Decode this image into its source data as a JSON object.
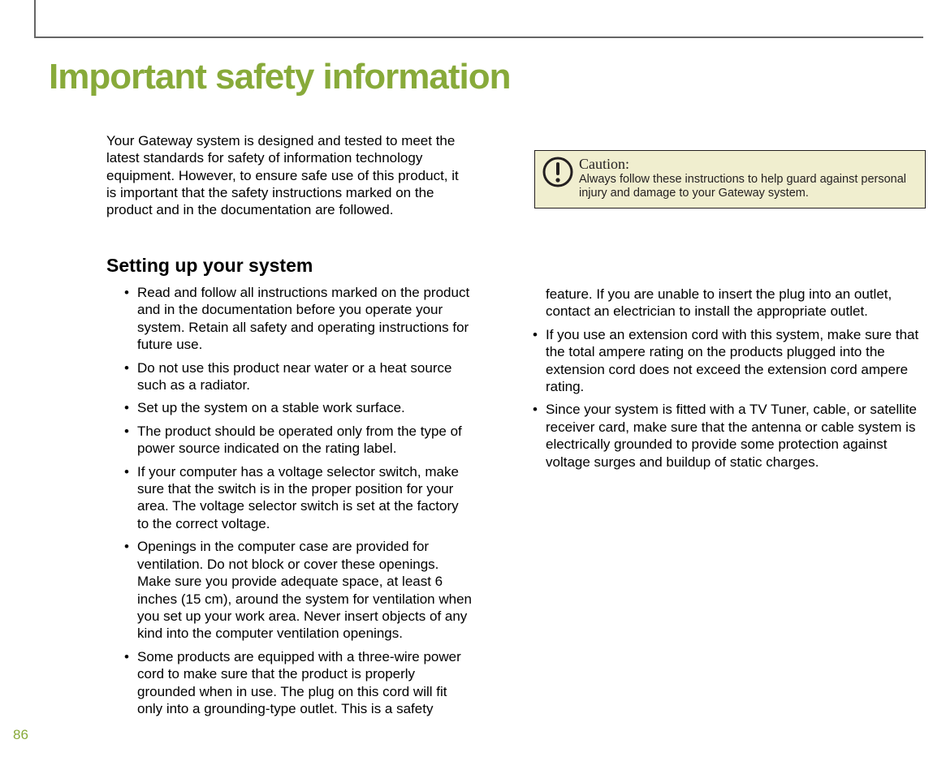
{
  "page_number": "86",
  "title": "Important safety information",
  "intro": "Your Gateway system is designed and tested to meet the latest standards for safety of information technology equipment. However, to ensure safe use of this product, it is important that the safety instructions marked on the product and in the documentation are followed.",
  "caution": {
    "label": "Caution:",
    "body": "Always follow these instructions to help guard against personal injury and damage to your Gateway system."
  },
  "section_heading": "Setting up your system",
  "left_bullets": [
    "Read and follow all instructions marked on the product and in the documentation before you operate your system. Retain all safety and operating instructions for future use.",
    "Do not use this product near water or a heat source such as a radiator.",
    "Set up the system on a stable work surface.",
    "The product should be operated only from the type of power source indicated on the rating label.",
    "If your computer has a voltage selector switch, make sure that the switch is in the proper position for your area. The voltage selector switch is set at the factory to the correct voltage.",
    "Openings in the computer case are provided for ventilation. Do not block or cover these openings. Make sure you provide adequate space, at least 6 inches (15 cm), around the system for ventilation when you set up your work area. Never insert objects of any kind into the computer ventilation openings.",
    "Some products are equipped with a three-wire power cord to make sure that the product is properly grounded when in use. The plug on this cord will fit only into a grounding-type outlet. This is a safety"
  ],
  "right_continuation": "feature. If you are unable to insert the plug into an outlet, contact an electrician to install the appropriate outlet.",
  "right_bullets": [
    "If you use an extension cord with this system, make sure that the total ampere rating on the products plugged into the extension cord does not exceed the extension cord ampere rating.",
    "Since your system is fitted with a TV Tuner, cable, or satellite receiver card, make sure that the antenna or cable system is electrically grounded to provide some protection against voltage surges and buildup of static charges."
  ]
}
